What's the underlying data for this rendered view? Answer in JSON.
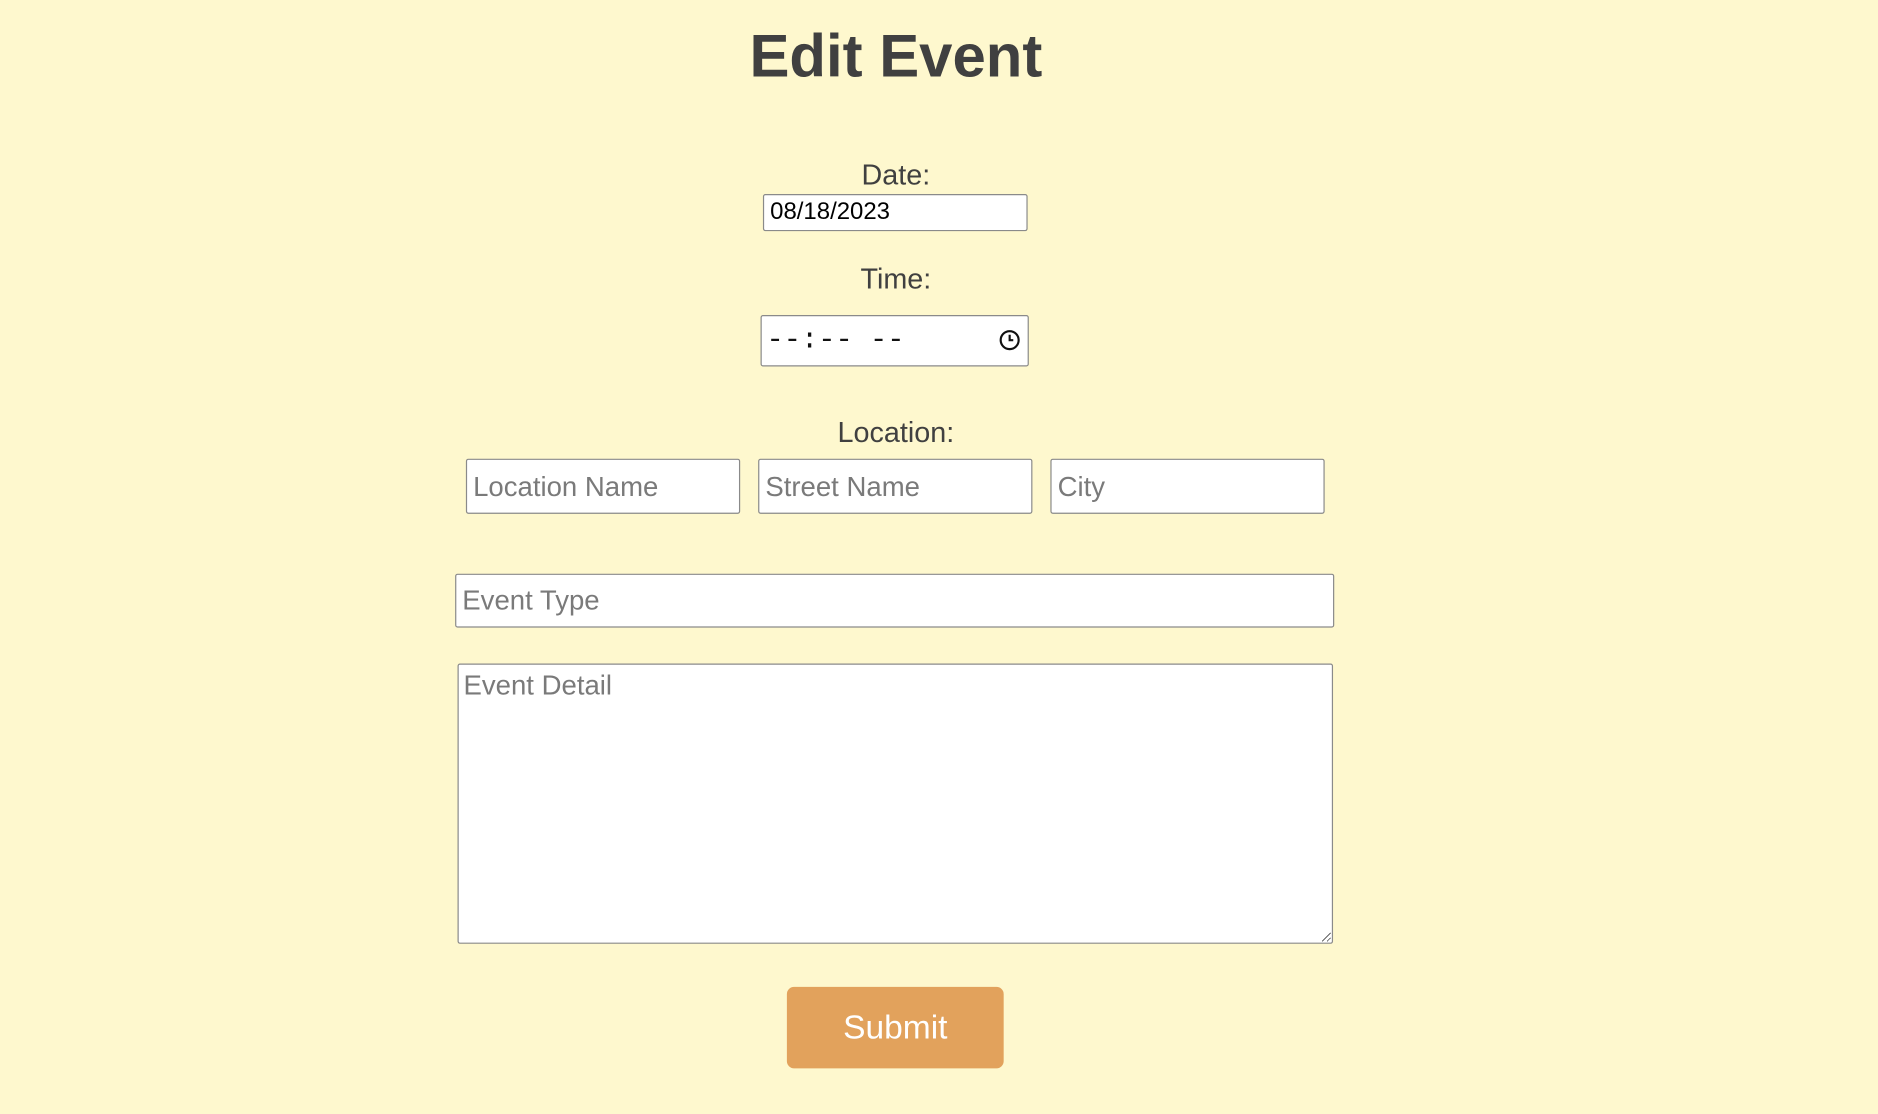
{
  "page": {
    "title": "Edit Event",
    "background_color": "#fef8ce"
  },
  "form": {
    "date_label": "Date:",
    "date_value": "08/18/2023",
    "time_label": "Time:",
    "time_value": "--:-- --",
    "time_icon": "clock-icon",
    "location_label": "Location:",
    "location_name_placeholder": "Location Name",
    "street_name_placeholder": "Street Name",
    "city_placeholder": "City",
    "event_type_placeholder": "Event Type",
    "event_detail_placeholder": "Event Detail",
    "submit_label": "Submit",
    "submit_color": "#e2a25c"
  }
}
